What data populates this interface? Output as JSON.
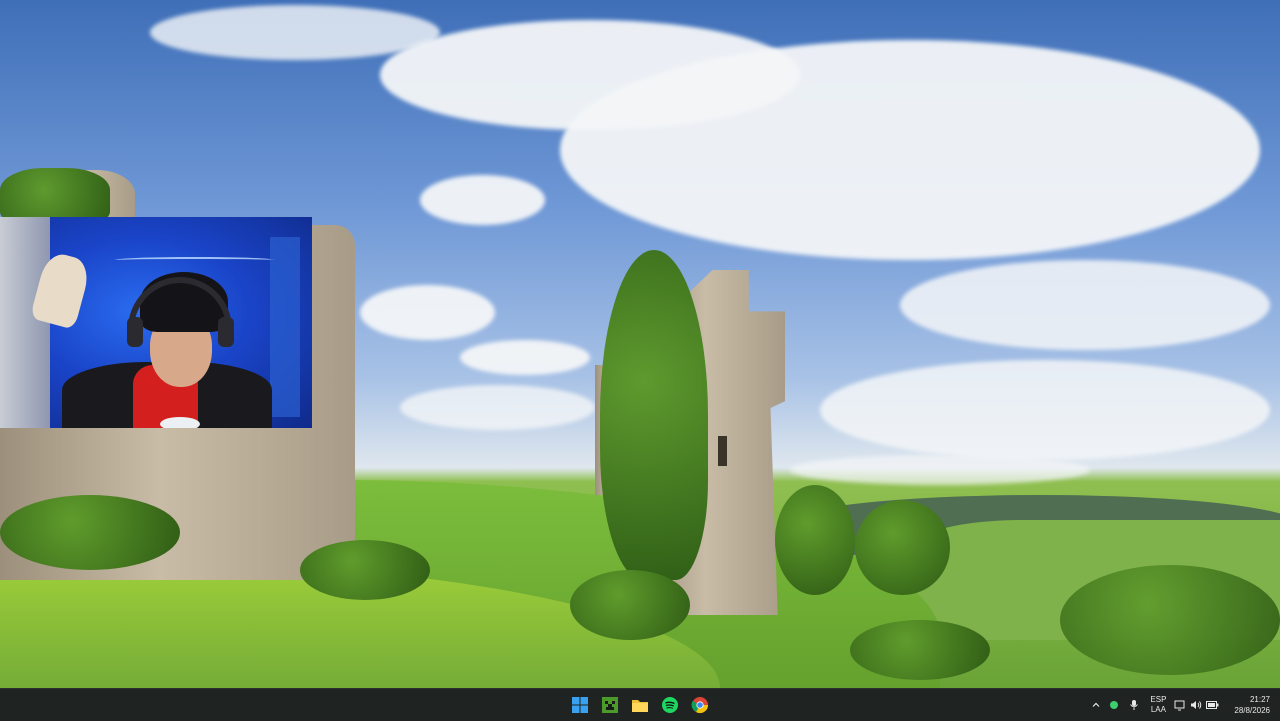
{
  "taskbar": {
    "apps": [
      {
        "name": "start",
        "icon": "windows-logo-icon"
      },
      {
        "name": "minecraft",
        "icon": "minecraft-icon"
      },
      {
        "name": "file-explorer",
        "icon": "folder-icon"
      },
      {
        "name": "spotify",
        "icon": "spotify-icon"
      },
      {
        "name": "chrome",
        "icon": "chrome-icon"
      }
    ],
    "tray": {
      "overflow_icon": "chevron-up-icon",
      "status_dot_color": "#3ccf6e",
      "mic_icon": "microphone-icon",
      "language": {
        "line1": "ESP",
        "line2": "LAA"
      },
      "network_icon": "network-icon",
      "volume_icon": "volume-icon",
      "battery_icon": "battery-icon",
      "time": "21:27",
      "date": "28/8/2026"
    }
  },
  "colors": {
    "taskbar_bg": "#1f2321",
    "sky": "#5a86c8",
    "grass": "#6aa436",
    "webcam_light": "#1a44c8"
  }
}
